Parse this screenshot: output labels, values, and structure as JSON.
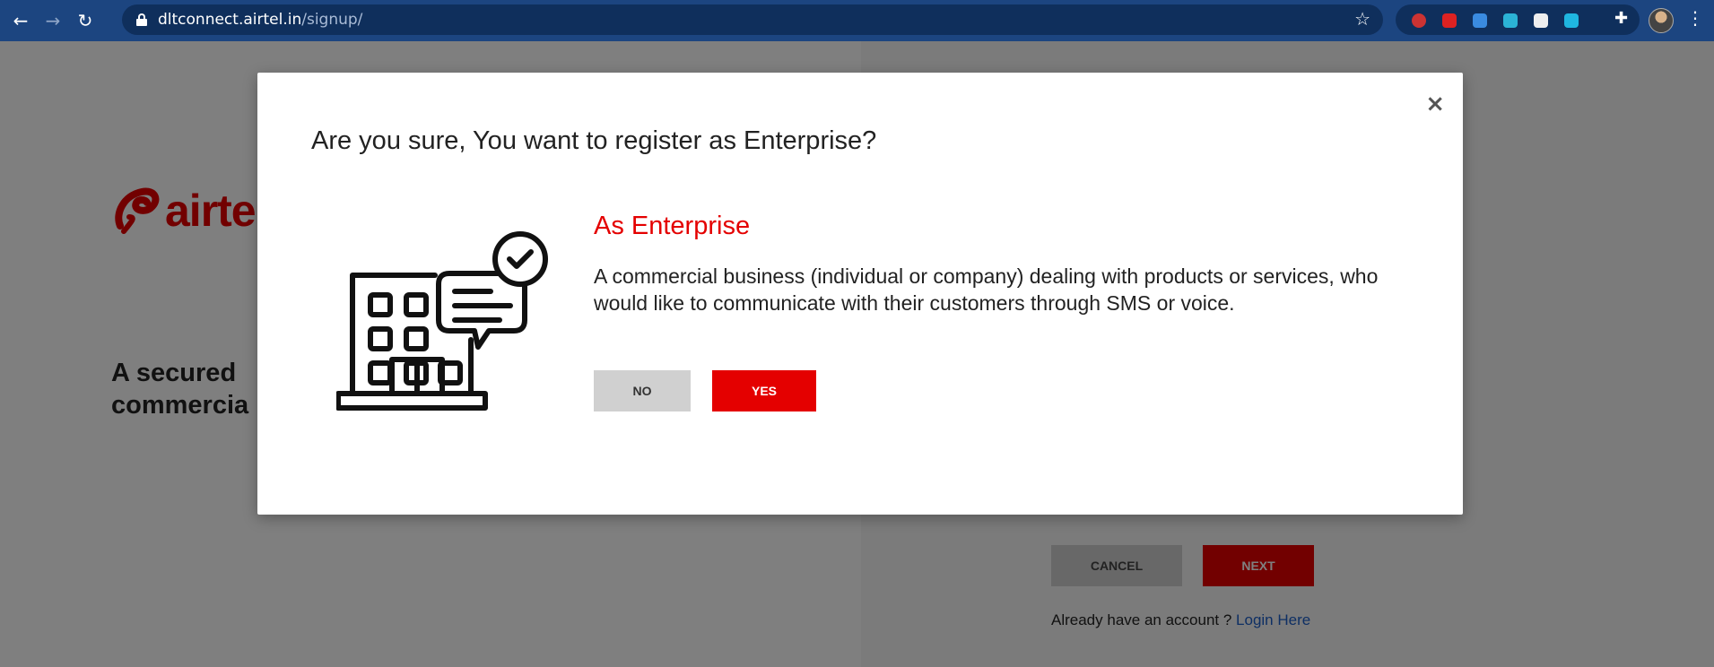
{
  "browser": {
    "url_host": "dltconnect.airtel.in",
    "url_path": "/signup/"
  },
  "background": {
    "logo_text": "airtel",
    "tagline_line1": "A secured",
    "tagline_line2": "commercia",
    "cancel_label": "CANCEL",
    "next_label": "NEXT",
    "login_prompt": "Already have an account ? ",
    "login_link": "Login Here"
  },
  "modal": {
    "close_symbol": "×",
    "title": "Are you sure, You want to register as Enterprise?",
    "heading": "As Enterprise",
    "description": "A commercial business (individual or company) dealing with products or services, who would like to communicate with their customers through SMS or voice.",
    "no_label": "NO",
    "yes_label": "YES"
  },
  "colors": {
    "brand_red": "#e40000",
    "chrome_blue": "#1c4580",
    "link_blue": "#1d5ec8"
  }
}
